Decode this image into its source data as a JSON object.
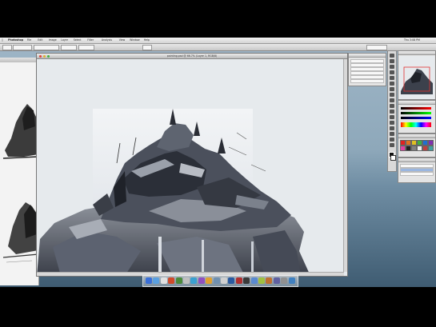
{
  "menubar": {
    "app_name": "Photoshop",
    "items": [
      "File",
      "Edit",
      "Image",
      "Layer",
      "Select",
      "Filter",
      "Analysis",
      "View",
      "Window",
      "Help"
    ],
    "clock": "Thu 3:08 PM"
  },
  "document": {
    "title": "painting.psd @ 66.7% (Layer 1, RGB/8)"
  },
  "panels": {
    "layers_rows": 6,
    "swatch_colors": [
      "#e02020",
      "#e07020",
      "#e0c020",
      "#40b040",
      "#2070d0",
      "#8030b0",
      "#e040a0",
      "#202020",
      "#808080",
      "#f0f0f0",
      "#c04040",
      "#40a0a0"
    ]
  },
  "dock": {
    "icon_colors": [
      "#3a6fd8",
      "#5aa0e0",
      "#e0e0e0",
      "#d04a2a",
      "#4a8a3a",
      "#c0c0c0",
      "#3aa0d0",
      "#9050c0",
      "#e0a030",
      "#7090b0",
      "#d0d0d0",
      "#2a5aa0",
      "#b03030",
      "#3a3a3a",
      "#5a8ad0",
      "#a0c040",
      "#c07030",
      "#6060a0",
      "#909090",
      "#4080c0"
    ]
  },
  "colors": {
    "ocean_top": "#9fb6c7",
    "ocean_bottom": "#3f5c72",
    "canvas_bg": "#e6eaed"
  }
}
